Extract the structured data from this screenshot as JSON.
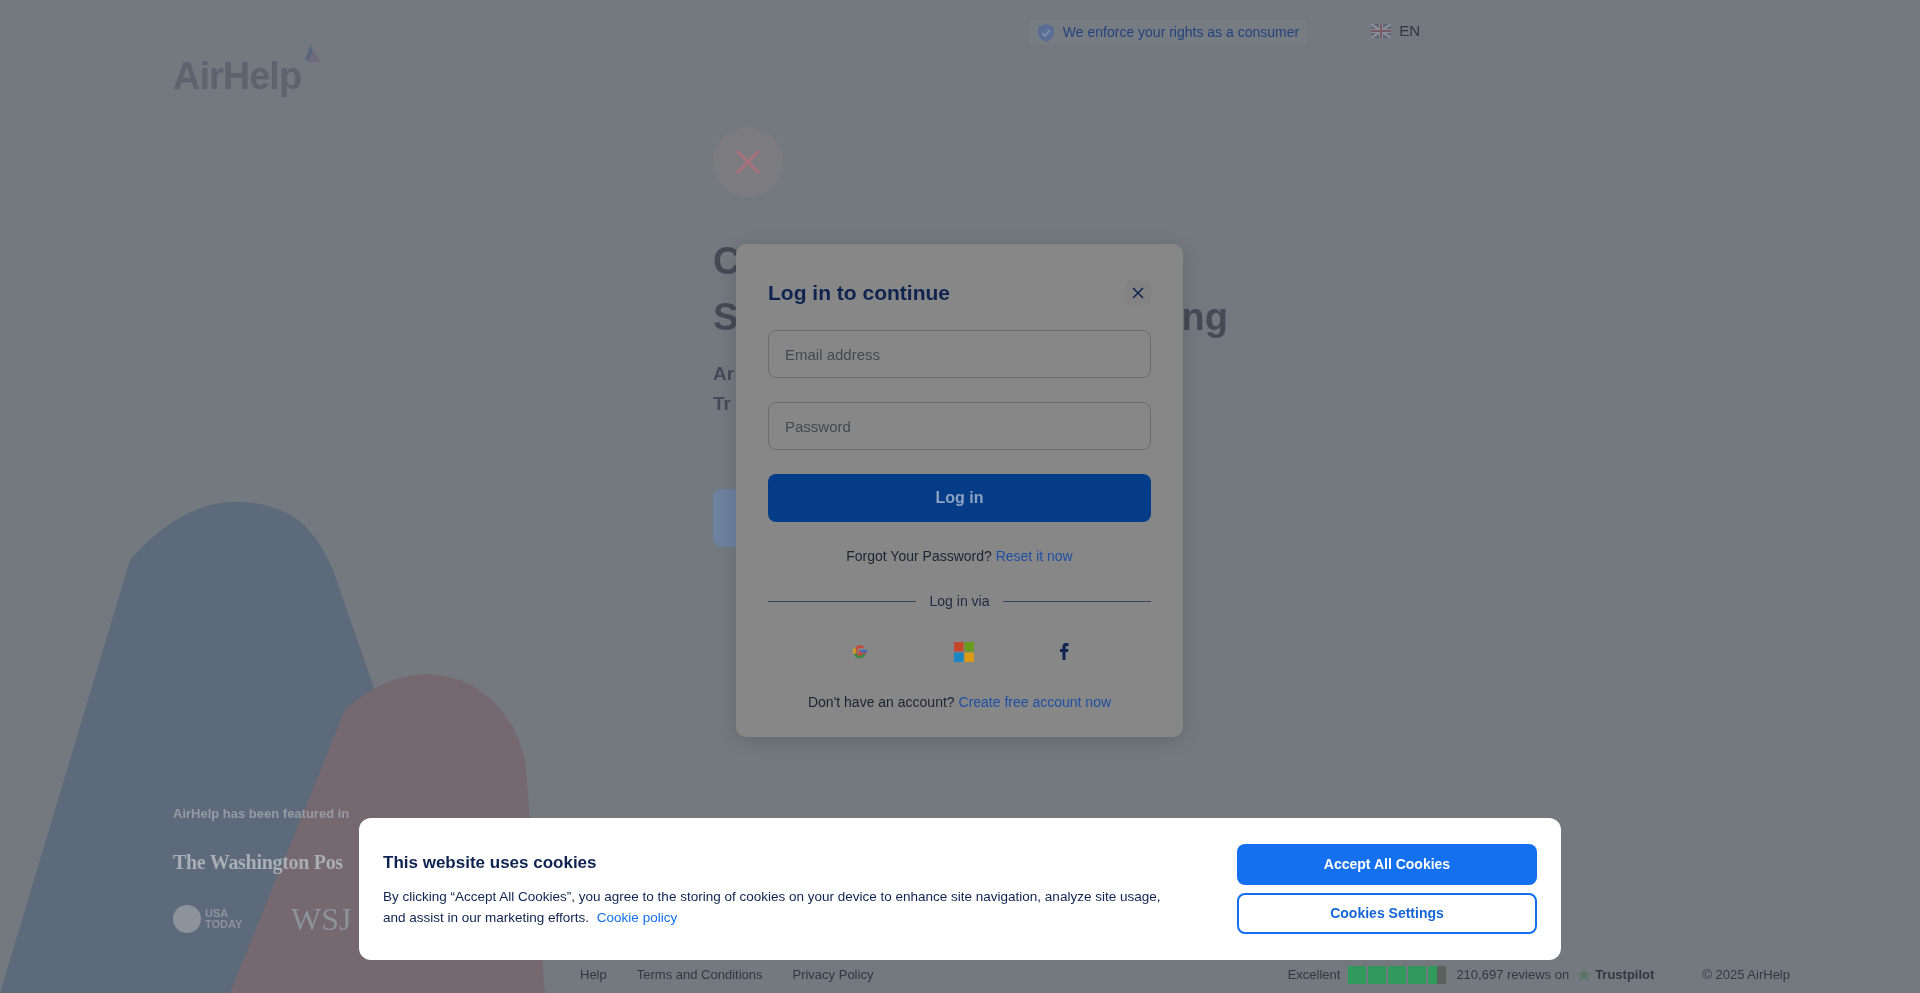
{
  "header": {
    "logo": "AirHelp",
    "tagline": "We enforce your rights as a consumer",
    "language": "EN"
  },
  "hero": {
    "heading_lines": [
      {
        "start": "C"
      },
      {
        "start": "S",
        "end": "ng"
      }
    ],
    "subtitle_lines": [
      {
        "start": "Ar"
      },
      {
        "start": "Tr"
      }
    ]
  },
  "featured": {
    "title": "AirHelp has been featured in",
    "logos": [
      {
        "kind": "blackletter",
        "text": "The Washington Pos"
      },
      {
        "kind": "badge",
        "text": "USA TODAY"
      },
      {
        "kind": "serif",
        "text": "WSJ"
      }
    ]
  },
  "footer": {
    "links": [
      "Help",
      "Terms and Conditions",
      "Privacy Policy"
    ],
    "rating_label": "Excellent",
    "stars": 4.5,
    "reviews": "210,697 reviews on",
    "brand": "Trustpilot",
    "copyright": "© 2025 AirHelp"
  },
  "login_modal": {
    "title": "Log in to continue",
    "fields": [
      {
        "placeholder": "Email address"
      },
      {
        "placeholder": "Password"
      }
    ],
    "submit": "Log in",
    "forgot": {
      "text": "Forgot Your Password?",
      "link": "Reset it now"
    },
    "divider": "Log in via",
    "providers": [
      {
        "kind": "google"
      },
      {
        "kind": "microsoft"
      },
      {
        "kind": "facebook"
      }
    ],
    "signup": {
      "text": "Don't have an account?",
      "link": "Create free account now"
    }
  },
  "cookie_banner": {
    "title": "This website uses cookies",
    "text": "By clicking “Accept All Cookies”, you agree to the storing of cookies on your device to enhance site navigation, analyze site usage, and assist in our marketing efforts.",
    "link": "Cookie policy",
    "buttons": [
      {
        "label": "Accept All Cookies",
        "kind": "primary"
      },
      {
        "label": "Cookies Settings",
        "kind": "outline"
      }
    ]
  }
}
